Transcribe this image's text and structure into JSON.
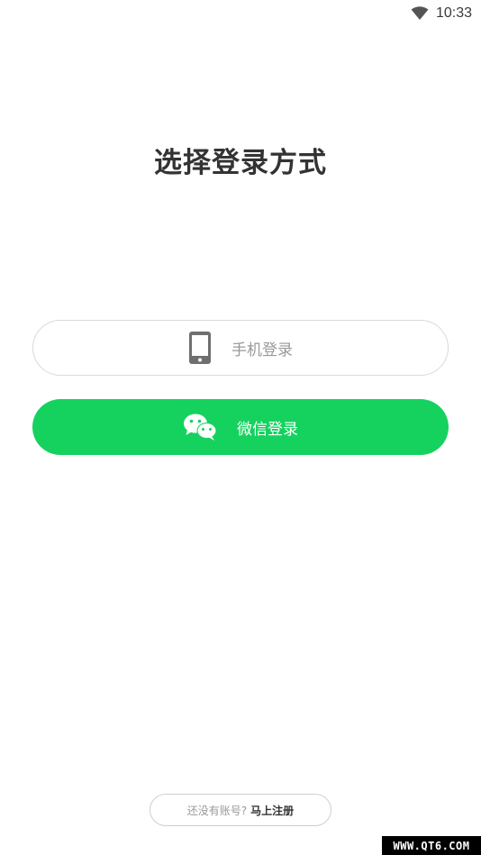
{
  "status_bar": {
    "time": "10:33",
    "wifi_icon": "wifi-icon"
  },
  "page": {
    "title": "选择登录方式"
  },
  "phone_login": {
    "label": "手机登录",
    "icon": "smartphone-icon"
  },
  "wechat_login": {
    "label": "微信登录",
    "icon": "wechat-icon",
    "color": "#15d25f"
  },
  "footer": {
    "question": "还没有账号?",
    "register_link": "马上注册"
  },
  "watermark": {
    "text": "WWW.QT6.COM"
  }
}
